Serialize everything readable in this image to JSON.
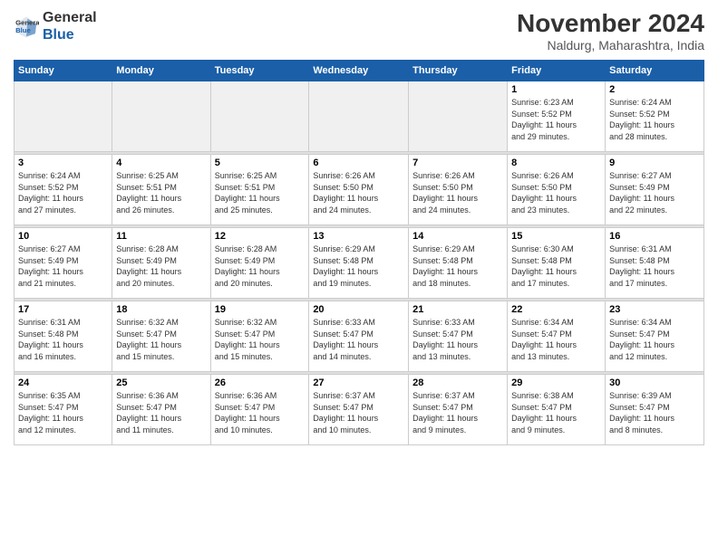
{
  "logo": {
    "line1": "General",
    "line2": "Blue"
  },
  "title": "November 2024",
  "subtitle": "Naldurg, Maharashtra, India",
  "headers": [
    "Sunday",
    "Monday",
    "Tuesday",
    "Wednesday",
    "Thursday",
    "Friday",
    "Saturday"
  ],
  "weeks": [
    [
      {
        "day": "",
        "info": ""
      },
      {
        "day": "",
        "info": ""
      },
      {
        "day": "",
        "info": ""
      },
      {
        "day": "",
        "info": ""
      },
      {
        "day": "",
        "info": ""
      },
      {
        "day": "1",
        "info": "Sunrise: 6:23 AM\nSunset: 5:52 PM\nDaylight: 11 hours\nand 29 minutes."
      },
      {
        "day": "2",
        "info": "Sunrise: 6:24 AM\nSunset: 5:52 PM\nDaylight: 11 hours\nand 28 minutes."
      }
    ],
    [
      {
        "day": "3",
        "info": "Sunrise: 6:24 AM\nSunset: 5:52 PM\nDaylight: 11 hours\nand 27 minutes."
      },
      {
        "day": "4",
        "info": "Sunrise: 6:25 AM\nSunset: 5:51 PM\nDaylight: 11 hours\nand 26 minutes."
      },
      {
        "day": "5",
        "info": "Sunrise: 6:25 AM\nSunset: 5:51 PM\nDaylight: 11 hours\nand 25 minutes."
      },
      {
        "day": "6",
        "info": "Sunrise: 6:26 AM\nSunset: 5:50 PM\nDaylight: 11 hours\nand 24 minutes."
      },
      {
        "day": "7",
        "info": "Sunrise: 6:26 AM\nSunset: 5:50 PM\nDaylight: 11 hours\nand 24 minutes."
      },
      {
        "day": "8",
        "info": "Sunrise: 6:26 AM\nSunset: 5:50 PM\nDaylight: 11 hours\nand 23 minutes."
      },
      {
        "day": "9",
        "info": "Sunrise: 6:27 AM\nSunset: 5:49 PM\nDaylight: 11 hours\nand 22 minutes."
      }
    ],
    [
      {
        "day": "10",
        "info": "Sunrise: 6:27 AM\nSunset: 5:49 PM\nDaylight: 11 hours\nand 21 minutes."
      },
      {
        "day": "11",
        "info": "Sunrise: 6:28 AM\nSunset: 5:49 PM\nDaylight: 11 hours\nand 20 minutes."
      },
      {
        "day": "12",
        "info": "Sunrise: 6:28 AM\nSunset: 5:49 PM\nDaylight: 11 hours\nand 20 minutes."
      },
      {
        "day": "13",
        "info": "Sunrise: 6:29 AM\nSunset: 5:48 PM\nDaylight: 11 hours\nand 19 minutes."
      },
      {
        "day": "14",
        "info": "Sunrise: 6:29 AM\nSunset: 5:48 PM\nDaylight: 11 hours\nand 18 minutes."
      },
      {
        "day": "15",
        "info": "Sunrise: 6:30 AM\nSunset: 5:48 PM\nDaylight: 11 hours\nand 17 minutes."
      },
      {
        "day": "16",
        "info": "Sunrise: 6:31 AM\nSunset: 5:48 PM\nDaylight: 11 hours\nand 17 minutes."
      }
    ],
    [
      {
        "day": "17",
        "info": "Sunrise: 6:31 AM\nSunset: 5:48 PM\nDaylight: 11 hours\nand 16 minutes."
      },
      {
        "day": "18",
        "info": "Sunrise: 6:32 AM\nSunset: 5:47 PM\nDaylight: 11 hours\nand 15 minutes."
      },
      {
        "day": "19",
        "info": "Sunrise: 6:32 AM\nSunset: 5:47 PM\nDaylight: 11 hours\nand 15 minutes."
      },
      {
        "day": "20",
        "info": "Sunrise: 6:33 AM\nSunset: 5:47 PM\nDaylight: 11 hours\nand 14 minutes."
      },
      {
        "day": "21",
        "info": "Sunrise: 6:33 AM\nSunset: 5:47 PM\nDaylight: 11 hours\nand 13 minutes."
      },
      {
        "day": "22",
        "info": "Sunrise: 6:34 AM\nSunset: 5:47 PM\nDaylight: 11 hours\nand 13 minutes."
      },
      {
        "day": "23",
        "info": "Sunrise: 6:34 AM\nSunset: 5:47 PM\nDaylight: 11 hours\nand 12 minutes."
      }
    ],
    [
      {
        "day": "24",
        "info": "Sunrise: 6:35 AM\nSunset: 5:47 PM\nDaylight: 11 hours\nand 12 minutes."
      },
      {
        "day": "25",
        "info": "Sunrise: 6:36 AM\nSunset: 5:47 PM\nDaylight: 11 hours\nand 11 minutes."
      },
      {
        "day": "26",
        "info": "Sunrise: 6:36 AM\nSunset: 5:47 PM\nDaylight: 11 hours\nand 10 minutes."
      },
      {
        "day": "27",
        "info": "Sunrise: 6:37 AM\nSunset: 5:47 PM\nDaylight: 11 hours\nand 10 minutes."
      },
      {
        "day": "28",
        "info": "Sunrise: 6:37 AM\nSunset: 5:47 PM\nDaylight: 11 hours\nand 9 minutes."
      },
      {
        "day": "29",
        "info": "Sunrise: 6:38 AM\nSunset: 5:47 PM\nDaylight: 11 hours\nand 9 minutes."
      },
      {
        "day": "30",
        "info": "Sunrise: 6:39 AM\nSunset: 5:47 PM\nDaylight: 11 hours\nand 8 minutes."
      }
    ]
  ]
}
